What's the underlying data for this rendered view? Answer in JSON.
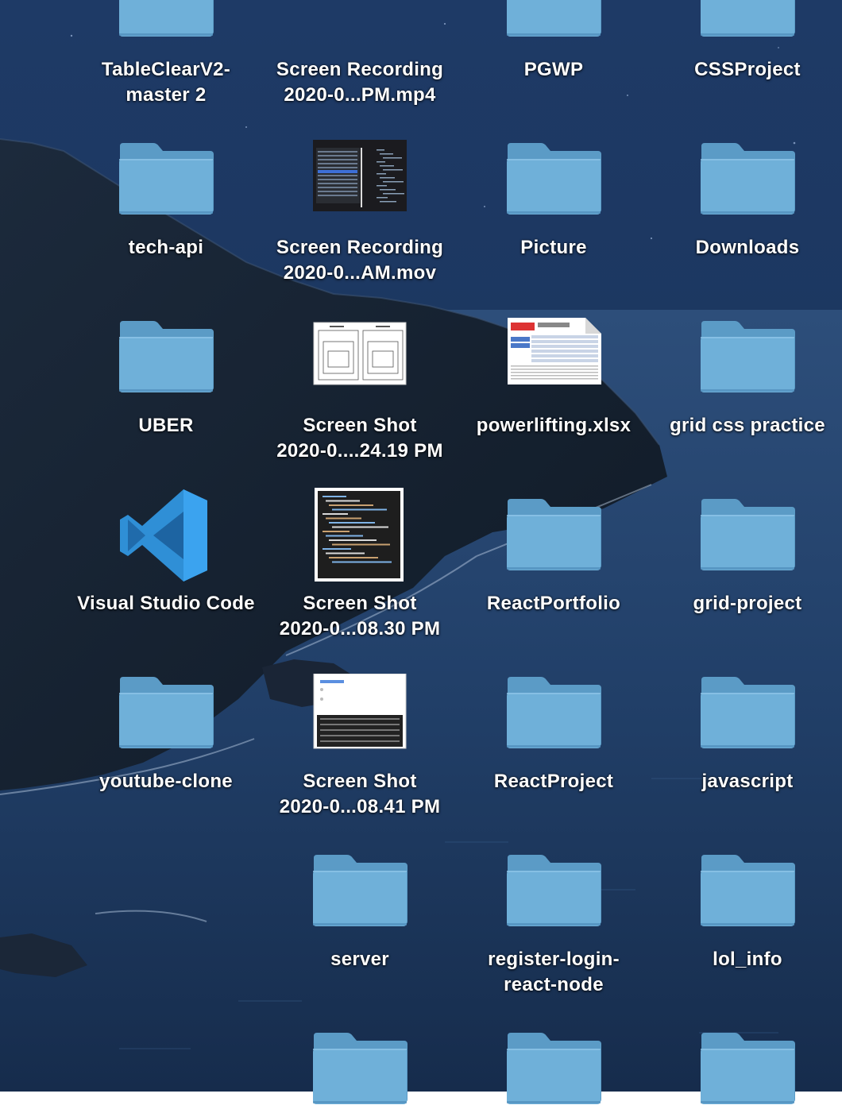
{
  "desktop": {
    "items": [
      {
        "name": "TableClearV2-",
        "name2": "master 2",
        "kind": "folder",
        "icon": "folder-icon"
      },
      {
        "name": "Screen Recording",
        "name2": "2020-0...PM.mp4",
        "kind": "video",
        "icon": "video-thumbnail"
      },
      {
        "name": "PGWP",
        "name2": "",
        "kind": "folder",
        "icon": "folder-icon"
      },
      {
        "name": "CSSProject",
        "name2": "",
        "kind": "folder",
        "icon": "folder-icon"
      },
      {
        "name": "tech-api",
        "name2": "",
        "kind": "folder",
        "icon": "folder-icon"
      },
      {
        "name": "Screen Recording",
        "name2": "2020-0...AM.mov",
        "kind": "video",
        "icon": "video-thumbnail"
      },
      {
        "name": "Picture",
        "name2": "",
        "kind": "folder",
        "icon": "folder-icon"
      },
      {
        "name": "Downloads",
        "name2": "",
        "kind": "folder",
        "icon": "folder-icon"
      },
      {
        "name": "UBER",
        "name2": "",
        "kind": "folder",
        "icon": "folder-icon"
      },
      {
        "name": "Screen Shot",
        "name2": "2020-0....24.19 PM",
        "kind": "image",
        "icon": "diagram-thumbnail"
      },
      {
        "name": "powerlifting.xlsx",
        "name2": "",
        "kind": "spreadsheet",
        "icon": "spreadsheet-icon"
      },
      {
        "name": "grid css practice",
        "name2": "",
        "kind": "folder",
        "icon": "folder-icon"
      },
      {
        "name": "Visual Studio Code",
        "name2": "",
        "kind": "app",
        "icon": "vscode-icon"
      },
      {
        "name": "Screen Shot",
        "name2": "2020-0...08.30 PM",
        "kind": "image",
        "icon": "code-thumbnail"
      },
      {
        "name": "ReactPortfolio",
        "name2": "",
        "kind": "folder",
        "icon": "folder-icon"
      },
      {
        "name": "grid-project",
        "name2": "",
        "kind": "folder",
        "icon": "folder-icon"
      },
      {
        "name": "youtube-clone",
        "name2": "",
        "kind": "folder",
        "icon": "folder-icon"
      },
      {
        "name": "Screen Shot",
        "name2": "2020-0...08.41 PM",
        "kind": "image",
        "icon": "ui-thumbnail"
      },
      {
        "name": "ReactProject",
        "name2": "",
        "kind": "folder",
        "icon": "folder-icon"
      },
      {
        "name": "javascript",
        "name2": "",
        "kind": "folder",
        "icon": "folder-icon"
      },
      {
        "name": "server",
        "name2": "",
        "kind": "folder",
        "icon": "folder-icon"
      },
      {
        "name": "register-login-",
        "name2": "react-node",
        "kind": "folder",
        "icon": "folder-icon"
      },
      {
        "name": "lol_info",
        "name2": "",
        "kind": "folder",
        "icon": "folder-icon"
      },
      {
        "name": "",
        "name2": "",
        "kind": "folder",
        "icon": "folder-icon"
      },
      {
        "name": "",
        "name2": "",
        "kind": "folder",
        "icon": "folder-icon"
      },
      {
        "name": "",
        "name2": "",
        "kind": "folder",
        "icon": "folder-icon"
      }
    ]
  },
  "colors": {
    "folder_front": "#6fb0d9",
    "folder_back": "#5b9bc6",
    "label_text": "#ffffff",
    "vscode_blue": "#2f8fd6"
  }
}
